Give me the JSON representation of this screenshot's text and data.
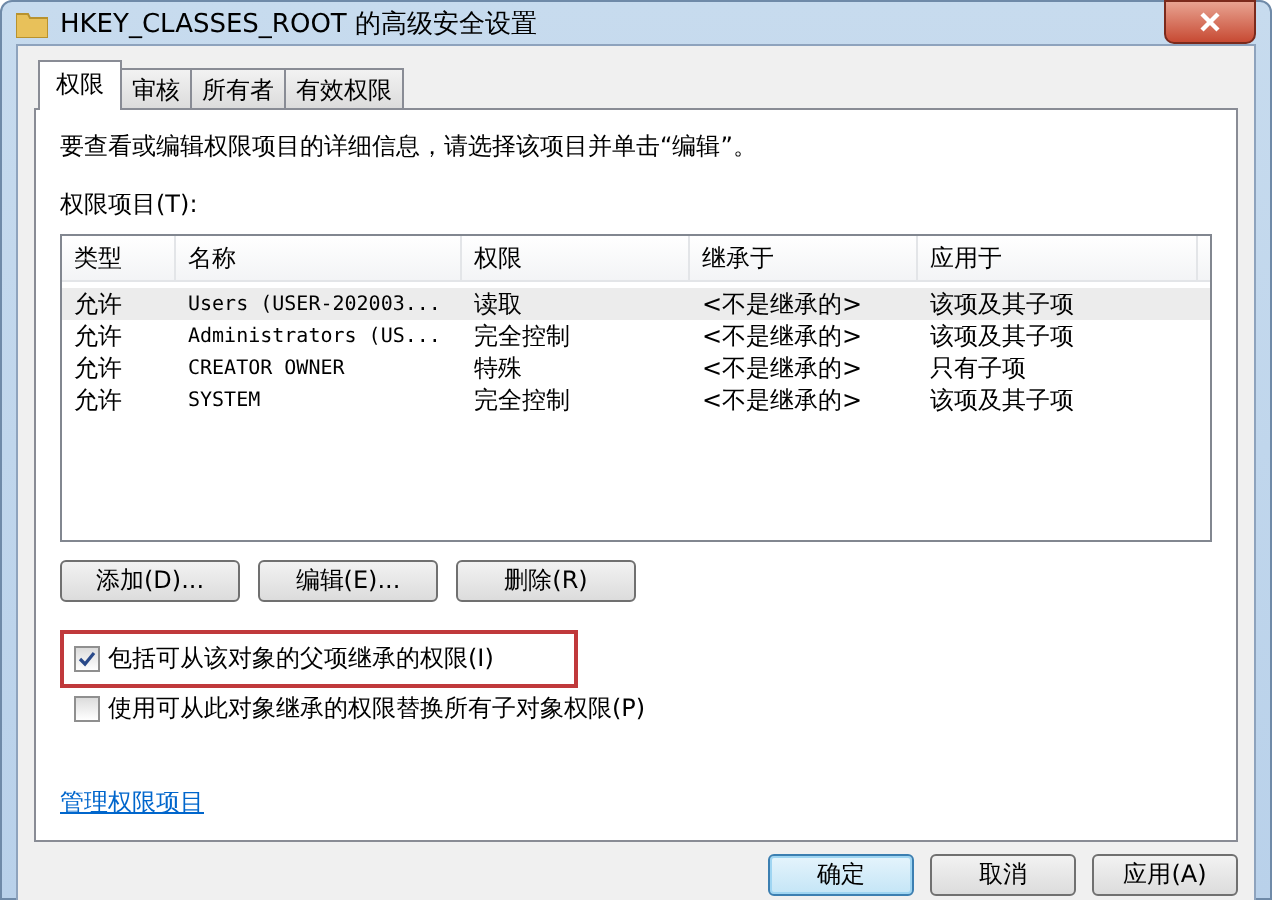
{
  "window": {
    "title": "HKEY_CLASSES_ROOT 的高级安全设置"
  },
  "tabs": [
    {
      "label": "权限",
      "selected": true
    },
    {
      "label": "审核",
      "selected": false
    },
    {
      "label": "所有者",
      "selected": false
    },
    {
      "label": "有效权限",
      "selected": false
    }
  ],
  "instructions": "要查看或编辑权限项目的详细信息，请选择该项目并单击“编辑”。",
  "entries_label": "权限项目(T):",
  "table": {
    "columns": [
      "类型",
      "名称",
      "权限",
      "继承于",
      "应用于"
    ],
    "rows": [
      {
        "cells": [
          "允许",
          "Users (USER-202003...",
          "读取",
          "<不是继承的>",
          "该项及其子项"
        ],
        "selected": true
      },
      {
        "cells": [
          "允许",
          "Administrators (US...",
          "完全控制",
          "<不是继承的>",
          "该项及其子项"
        ],
        "selected": false
      },
      {
        "cells": [
          "允许",
          "CREATOR OWNER",
          "特殊",
          "<不是继承的>",
          "只有子项"
        ],
        "selected": false
      },
      {
        "cells": [
          "允许",
          "SYSTEM",
          "完全控制",
          "<不是继承的>",
          "该项及其子项"
        ],
        "selected": false
      }
    ]
  },
  "entry_buttons": [
    "添加(D)...",
    "编辑(E)...",
    "删除(R)"
  ],
  "options": [
    {
      "label": "包括可从该对象的父项继承的权限(I)",
      "checked": true,
      "highlighted": true
    },
    {
      "label": "使用可从此对象继承的权限替换所有子对象权限(P)",
      "checked": false,
      "highlighted": false
    }
  ],
  "link": "管理权限项目",
  "footer_buttons": [
    {
      "label": "确定",
      "default": true
    },
    {
      "label": "取消",
      "default": false
    },
    {
      "label": "应用(A)",
      "default": false
    }
  ]
}
